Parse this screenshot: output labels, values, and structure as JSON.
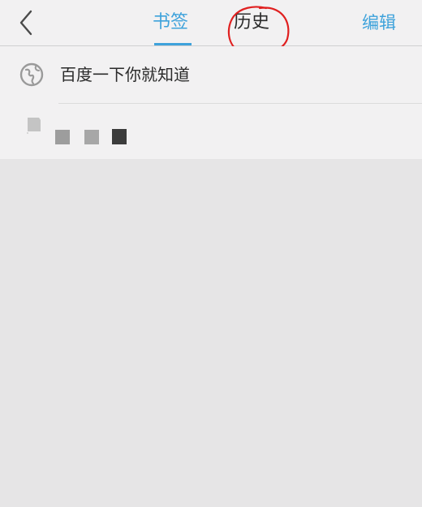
{
  "header": {
    "back_icon": "chevron-left-icon",
    "tabs": [
      {
        "label": "书签",
        "active": true
      },
      {
        "label": "历史",
        "active": false
      }
    ],
    "edit_label": "编辑"
  },
  "bookmarks": [
    {
      "title": "百度一下你就知道",
      "icon": "globe-icon"
    }
  ],
  "colors": {
    "accent": "#3ea2db",
    "annotation": "#e02020",
    "background": "#e6e5e6",
    "surface": "#f2f1f2"
  }
}
